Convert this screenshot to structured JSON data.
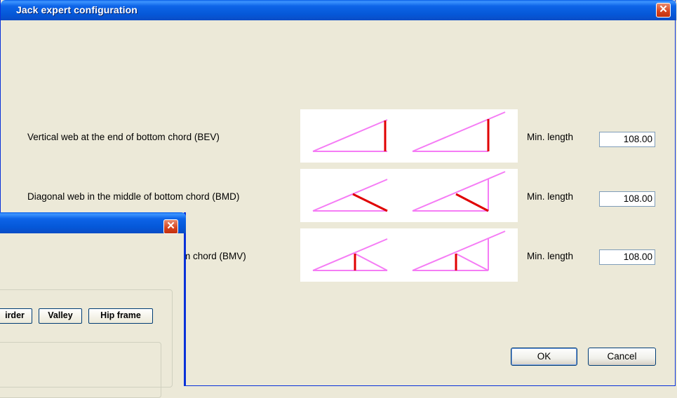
{
  "window": {
    "title": "Jack expert configuration",
    "close_glyph": "✕"
  },
  "rows": [
    {
      "label": "Vertical web at the end of bottom chord (BEV)",
      "min_label": "Min. length",
      "value": "108.00"
    },
    {
      "label": "Diagonal web in the middle of bottom chord (BMD)",
      "min_label": "Min. length",
      "value": "108.00"
    },
    {
      "label": "ttom chord (BMV)",
      "min_label": "Min. length",
      "value": "108.00"
    }
  ],
  "buttons": {
    "ok": "OK",
    "cancel": "Cancel"
  },
  "background_window": {
    "close_glyph": "✕",
    "tabs": [
      "irder",
      "Valley",
      "Hip frame"
    ]
  },
  "colors": {
    "chord": "#f57cf5",
    "web": "#e00000",
    "title_bar": "#0558d8"
  }
}
